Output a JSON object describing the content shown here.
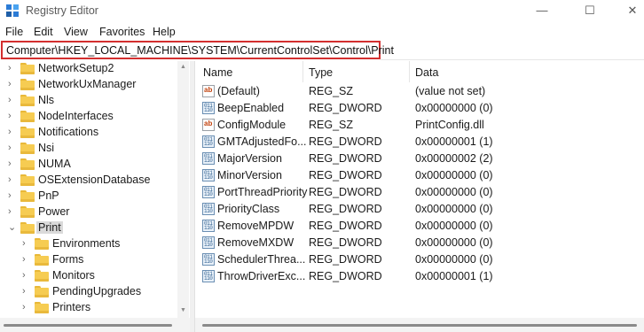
{
  "window": {
    "title": "Registry Editor",
    "minimize": "—",
    "maximize": "☐",
    "close": "✕"
  },
  "menu": [
    "File",
    "Edit",
    "View",
    "Favorites",
    "Help"
  ],
  "address": "Computer\\HKEY_LOCAL_MACHINE\\SYSTEM\\CurrentControlSet\\Control\\Print",
  "tree": [
    {
      "label": "NetworkSetup2",
      "level": 0,
      "expanded": false
    },
    {
      "label": "NetworkUxManager",
      "level": 0,
      "expanded": false
    },
    {
      "label": "Nls",
      "level": 0,
      "expanded": false
    },
    {
      "label": "NodeInterfaces",
      "level": 0,
      "expanded": false
    },
    {
      "label": "Notifications",
      "level": 0,
      "expanded": false
    },
    {
      "label": "Nsi",
      "level": 0,
      "expanded": false
    },
    {
      "label": "NUMA",
      "level": 0,
      "expanded": false
    },
    {
      "label": "OSExtensionDatabase",
      "level": 0,
      "expanded": false
    },
    {
      "label": "PnP",
      "level": 0,
      "expanded": false
    },
    {
      "label": "Power",
      "level": 0,
      "expanded": false
    },
    {
      "label": "Print",
      "level": 0,
      "expanded": true,
      "selected": true
    },
    {
      "label": "Environments",
      "level": 1,
      "expanded": false
    },
    {
      "label": "Forms",
      "level": 1,
      "expanded": false
    },
    {
      "label": "Monitors",
      "level": 1,
      "expanded": false
    },
    {
      "label": "PendingUpgrades",
      "level": 1,
      "expanded": false
    },
    {
      "label": "Printers",
      "level": 1,
      "expanded": false
    }
  ],
  "list": {
    "headers": {
      "name": "Name",
      "type": "Type",
      "data": "Data"
    },
    "rows": [
      {
        "name": "(Default)",
        "type": "REG_SZ",
        "data": "(value not set)",
        "icon": "string-value-icon"
      },
      {
        "name": "BeepEnabled",
        "type": "REG_DWORD",
        "data": "0x00000000 (0)",
        "icon": "dword-value-icon"
      },
      {
        "name": "ConfigModule",
        "type": "REG_SZ",
        "data": "PrintConfig.dll",
        "icon": "string-value-icon"
      },
      {
        "name": "GMTAdjustedFo...",
        "type": "REG_DWORD",
        "data": "0x00000001 (1)",
        "icon": "dword-value-icon"
      },
      {
        "name": "MajorVersion",
        "type": "REG_DWORD",
        "data": "0x00000002 (2)",
        "icon": "dword-value-icon"
      },
      {
        "name": "MinorVersion",
        "type": "REG_DWORD",
        "data": "0x00000000 (0)",
        "icon": "dword-value-icon"
      },
      {
        "name": "PortThreadPriority",
        "type": "REG_DWORD",
        "data": "0x00000000 (0)",
        "icon": "dword-value-icon"
      },
      {
        "name": "PriorityClass",
        "type": "REG_DWORD",
        "data": "0x00000000 (0)",
        "icon": "dword-value-icon"
      },
      {
        "name": "RemoveMPDW",
        "type": "REG_DWORD",
        "data": "0x00000000 (0)",
        "icon": "dword-value-icon"
      },
      {
        "name": "RemoveMXDW",
        "type": "REG_DWORD",
        "data": "0x00000000 (0)",
        "icon": "dword-value-icon"
      },
      {
        "name": "SchedulerThrea...",
        "type": "REG_DWORD",
        "data": "0x00000000 (0)",
        "icon": "dword-value-icon"
      },
      {
        "name": "ThrowDriverExc...",
        "type": "REG_DWORD",
        "data": "0x00000001 (1)",
        "icon": "dword-value-icon"
      }
    ]
  },
  "colors": {
    "highlight_border": "#d32f2f",
    "folder": "#f6cc52",
    "selected_bg": "#dadada"
  }
}
